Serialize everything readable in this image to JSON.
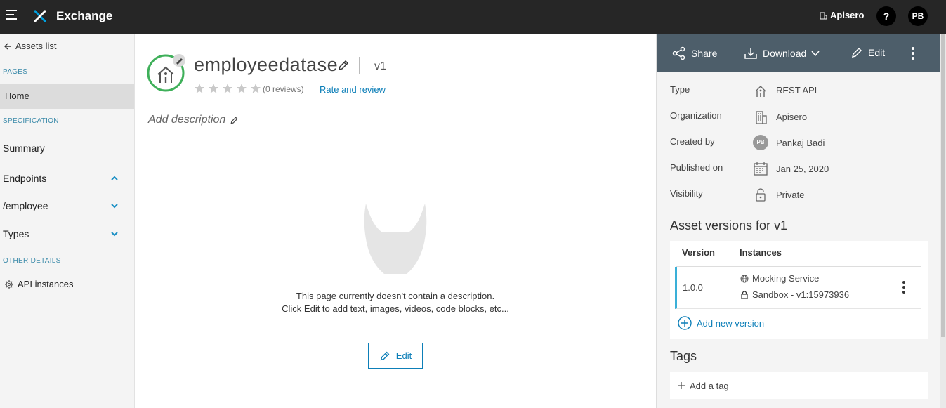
{
  "header": {
    "app_title": "Exchange",
    "org_name": "Apisero",
    "help_label": "?",
    "user_initials": "PB"
  },
  "sidebar": {
    "back_label": "Assets list",
    "pages_label": "PAGES",
    "home_label": "Home",
    "spec_label": "SPECIFICATION",
    "summary_label": "Summary",
    "endpoints_label": "Endpoints",
    "employee_label": "/employee",
    "types_label": "Types",
    "other_label": "OTHER DETAILS",
    "api_instances_label": "API instances"
  },
  "asset": {
    "name": "employeedatase",
    "version": "v1",
    "rating": 0,
    "reviews": "(0 reviews)",
    "rate_link": "Rate and review",
    "add_description": "Add description",
    "empty_line1": "This page currently doesn't contain a description.",
    "empty_line2": "Click Edit to add text, images, videos, code blocks, etc...",
    "edit_label": "Edit"
  },
  "panel": {
    "share_label": "Share",
    "download_label": "Download",
    "edit_label": "Edit",
    "meta": {
      "type_label": "Type",
      "type_value": "REST API",
      "org_label": "Organization",
      "org_value": "Apisero",
      "created_label": "Created by",
      "created_initials": "PB",
      "created_value": "Pankaj Badi",
      "published_label": "Published on",
      "published_value": "Jan 25, 2020",
      "visibility_label": "Visibility",
      "visibility_value": "Private"
    },
    "versions_title": "Asset versions for v1",
    "versions_table": {
      "col_version": "Version",
      "col_instances": "Instances",
      "row_version": "1.0.0",
      "instance_1": "Mocking Service",
      "instance_2": "Sandbox - v1:15973936"
    },
    "add_version_label": "Add new version",
    "tags_title": "Tags",
    "add_tag_label": "Add a tag"
  },
  "colors": {
    "topbar": "#262626",
    "toolbar": "#4d5e6a",
    "link": "#0d7fb8",
    "accent_green": "#3fb05a",
    "version_row_border": "#3ab0d8"
  }
}
